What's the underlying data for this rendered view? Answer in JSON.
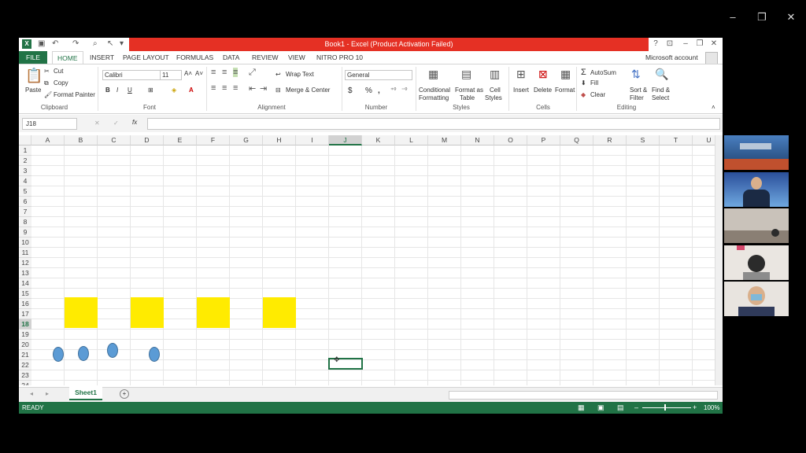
{
  "window": {
    "title": "Book1 -  Excel (Product Activation Failed)",
    "outer_minimize": "–",
    "outer_restore": "❐",
    "outer_close": "✕",
    "help": "?",
    "minimize": "–",
    "restore": "❐",
    "close": "✕"
  },
  "tabs": [
    "FILE",
    "HOME",
    "INSERT",
    "PAGE LAYOUT",
    "FORMULAS",
    "DATA",
    "REVIEW",
    "VIEW",
    "NITRO PRO 10"
  ],
  "account": "Microsoft account",
  "ribbon": {
    "clipboard": {
      "paste": "Paste",
      "cut": "Cut",
      "copy": "Copy",
      "format_painter": "Format Painter",
      "label": "Clipboard"
    },
    "font": {
      "name": "Calibri",
      "size": "11",
      "bold": "B",
      "italic": "I",
      "underline": "U",
      "label": "Font"
    },
    "alignment": {
      "wrap": "Wrap Text",
      "merge": "Merge & Center",
      "label": "Alignment"
    },
    "number": {
      "format": "General",
      "currency": "$",
      "percent": "%",
      "comma": ",",
      "label": "Number"
    },
    "styles": {
      "conditional": "Conditional",
      "conditional2": "Formatting",
      "format_as": "Format as",
      "format_as2": "Table",
      "cell": "Cell",
      "cell2": "Styles",
      "label": "Styles"
    },
    "cells": {
      "insert": "Insert",
      "delete": "Delete",
      "format": "Format",
      "label": "Cells"
    },
    "editing": {
      "autosum": "AutoSum",
      "fill": "Fill",
      "clear": "Clear",
      "sort": "Sort &",
      "sort2": "Filter",
      "find": "Find &",
      "find2": "Select",
      "label": "Editing"
    }
  },
  "formula_bar": {
    "name_box": "J18",
    "fx": "fx"
  },
  "columns": [
    "A",
    "B",
    "C",
    "D",
    "E",
    "F",
    "G",
    "H",
    "I",
    "J",
    "K",
    "L",
    "M",
    "N",
    "O",
    "P",
    "Q",
    "R",
    "S",
    "T",
    "U"
  ],
  "rows": [
    "1",
    "2",
    "3",
    "4",
    "5",
    "6",
    "7",
    "8",
    "9",
    "10",
    "11",
    "12",
    "13",
    "14",
    "15",
    "16",
    "17",
    "18",
    "19",
    "20",
    "21",
    "22",
    "23",
    "24"
  ],
  "selected_cell": "J18",
  "sheet_tab": "Sheet1",
  "status": {
    "ready": "READY",
    "zoom": "100%"
  }
}
